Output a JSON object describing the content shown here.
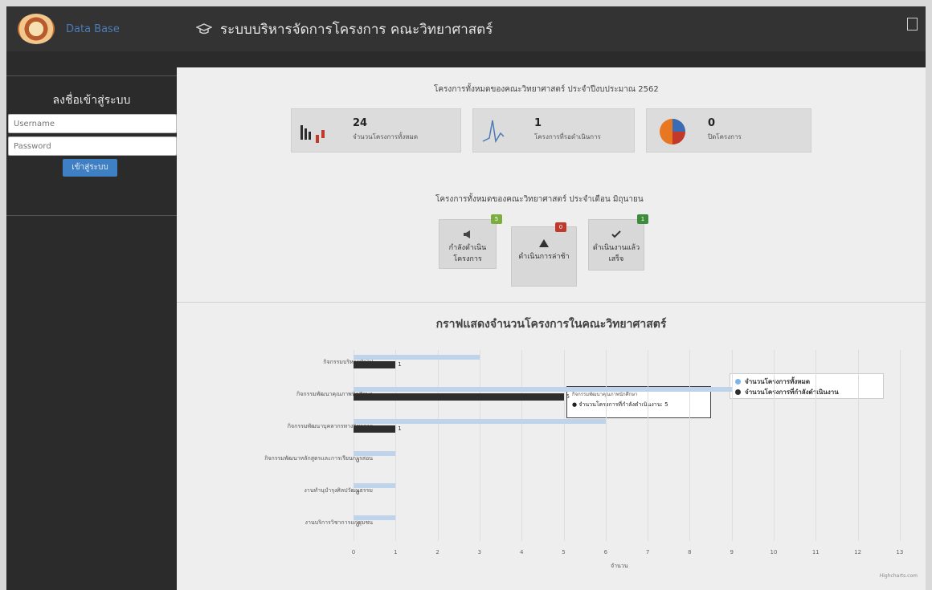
{
  "header": {
    "brand": "Data Base",
    "title": "ระบบบริหารจัดการโครงการ คณะวิทยาศาสตร์"
  },
  "sidebar": {
    "title": "ลงชื่อเข้าสู่ระบบ",
    "username_placeholder": "Username",
    "password_placeholder": "Password",
    "login_label": "เข้าสู่ระบบ"
  },
  "summary": {
    "title": "โครงการทั้งหมดของคณะวิทยาศาสตร์ ประจำปีงบประมาณ 2562",
    "cards": [
      {
        "value": "24",
        "label": "จำนวนโครงการทั้งหมด"
      },
      {
        "value": "1",
        "label": "โครงการที่รอดำเนินการ"
      },
      {
        "value": "0",
        "label": "ปิดโครงการ"
      }
    ]
  },
  "monthly": {
    "title": "โครงการทั้งหมดของคณะวิทยาศาสตร์ ประจำเดือน มิถุนายน",
    "items": [
      {
        "line1": "กำลังดำเนิน",
        "line2": "โครงการ",
        "badge": "5"
      },
      {
        "line1": "ดำเนินการล่าช้า",
        "line2": "",
        "badge": "0"
      },
      {
        "line1": "ดำเนินงานแล้ว",
        "line2": "เสร็จ",
        "badge": "1"
      }
    ]
  },
  "chart": {
    "tooltip_title": "กิจกรรมพัฒนาคุณภาพนักศึกษา",
    "tooltip_value": "● จำนวนโครงการที่กำลังดำเนินงาน: 5",
    "credits": "Highcharts.com"
  },
  "chart_data": {
    "type": "bar",
    "title": "กราฟแสดงจำนวนโครงการในคณะวิทยาศาสตร์",
    "xlabel": "จำนวน",
    "ylabel": "",
    "categories": [
      "กิจกรรมบริหารทั่วไป",
      "กิจกรรมพัฒนาคุณภาพนักศึกษา",
      "กิจกรรมพัฒนาบุคลากรทางวิชาการ",
      "กิจกรรมพัฒนาหลักสูตรและการเรียนการสอน",
      "งานทำนุบำรุงศิลปวัฒนธรรม",
      "งานบริการวิชาการแก่ชุมชน"
    ],
    "series": [
      {
        "name": "จำนวนโครงการทั้งหมด",
        "color": "#7cb5ec",
        "values": [
          3,
          9,
          6,
          1,
          1,
          1
        ]
      },
      {
        "name": "จำนวนโครงการที่กำลังดำเนินงาน",
        "color": "#2d2d2d",
        "values": [
          1,
          5,
          1,
          0,
          0,
          0
        ]
      }
    ],
    "xlim": [
      0,
      13
    ],
    "ticks": [
      "0",
      "1",
      "2",
      "3",
      "4",
      "5",
      "6",
      "7",
      "8",
      "9",
      "10",
      "11",
      "12",
      "13"
    ],
    "legend": "right",
    "grid": true
  }
}
